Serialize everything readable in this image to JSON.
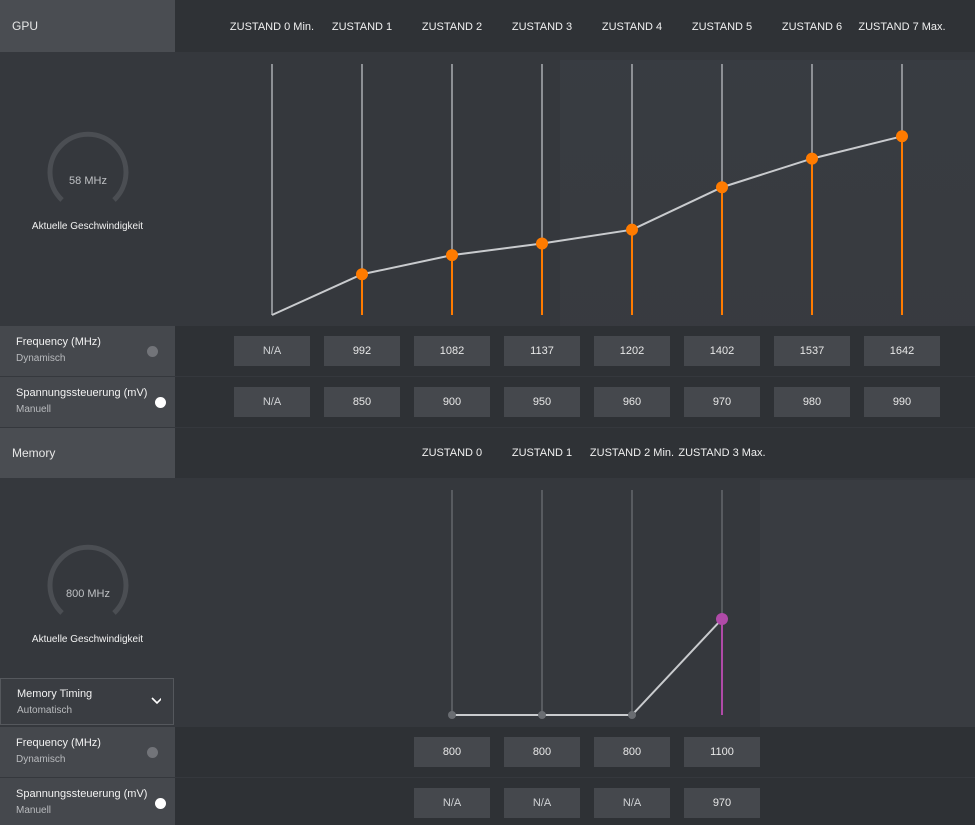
{
  "gpu": {
    "label": "GPU",
    "states": [
      "ZUSTAND 0 Min.",
      "ZUSTAND 1",
      "ZUSTAND 2",
      "ZUSTAND 3",
      "ZUSTAND 4",
      "ZUSTAND 5",
      "ZUSTAND 6",
      "ZUSTAND 7 Max."
    ],
    "gauge": {
      "value": "58 MHz",
      "caption": "Aktuelle Geschwindigkeit"
    },
    "frequency": {
      "title": "Frequency (MHz)",
      "mode": "Dynamisch",
      "values": [
        "N/A",
        "992",
        "1082",
        "1137",
        "1202",
        "1402",
        "1537",
        "1642"
      ]
    },
    "voltage": {
      "title": "Spannungssteuerung (mV)",
      "mode": "Manuell",
      "values": [
        "N/A",
        "850",
        "900",
        "950",
        "960",
        "970",
        "980",
        "990"
      ]
    },
    "accent": "#ff7b00"
  },
  "memory": {
    "label": "Memory",
    "states": [
      "ZUSTAND 0",
      "ZUSTAND 1",
      "ZUSTAND 2 Min.",
      "ZUSTAND 3 Max."
    ],
    "gauge": {
      "value": "800 MHz",
      "caption": "Aktuelle Geschwindigkeit"
    },
    "timing": {
      "title": "Memory Timing",
      "mode": "Automatisch"
    },
    "frequency": {
      "title": "Frequency (MHz)",
      "mode": "Dynamisch",
      "values": [
        "800",
        "800",
        "800",
        "1100"
      ]
    },
    "voltage": {
      "title": "Spannungssteuerung (mV)",
      "mode": "Manuell",
      "values": [
        "N/A",
        "N/A",
        "N/A",
        "970"
      ]
    },
    "accent": "#b04aa8"
  }
}
